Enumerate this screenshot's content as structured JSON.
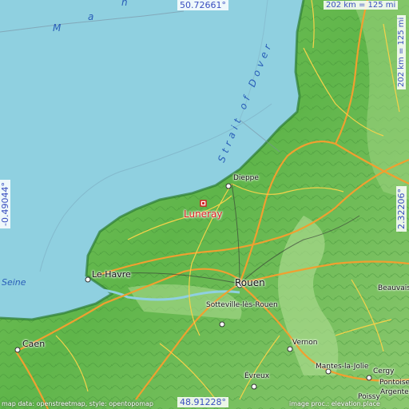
{
  "map": {
    "coords": {
      "top": "50.72661°",
      "bottom": "48.91228°",
      "left": "-0.49044°",
      "right": "2.32206°"
    },
    "scale": {
      "horizontal": "202 km = 125 mi",
      "vertical": "202 km = 125 mi"
    },
    "target": "Luneray",
    "cities": {
      "dieppe": "Dieppe",
      "le_havre": "Le Havre",
      "rouen": "Rouen",
      "sotteville": "Sotteville-lès-Rouen",
      "caen": "Caen",
      "evreux": "Évreux",
      "vernon": "Vernon",
      "mantes": "Mantes-la-Jolie",
      "cergy": "Cergy",
      "pontoise": "Pontoise",
      "argenteuil": "Argenteuil",
      "poissy": "Poissy",
      "beauvais": "Beauvais"
    },
    "water": {
      "channel_letters": [
        "M",
        "a",
        "n"
      ],
      "strait": "Strait of Dover",
      "seine": "Seine"
    },
    "attribution": {
      "left": "map data: openstreetmap, style: opentopomap",
      "right": "image proc.: elevation.place"
    },
    "colors": {
      "sea": "#8fd0e0",
      "land": "#5fb54a",
      "land_light": "#a8d88c",
      "road_major": "#f0a030",
      "road_minor": "#f5d24a",
      "target_marker": "#d22222",
      "label_blue": "#3a4fc0"
    }
  }
}
